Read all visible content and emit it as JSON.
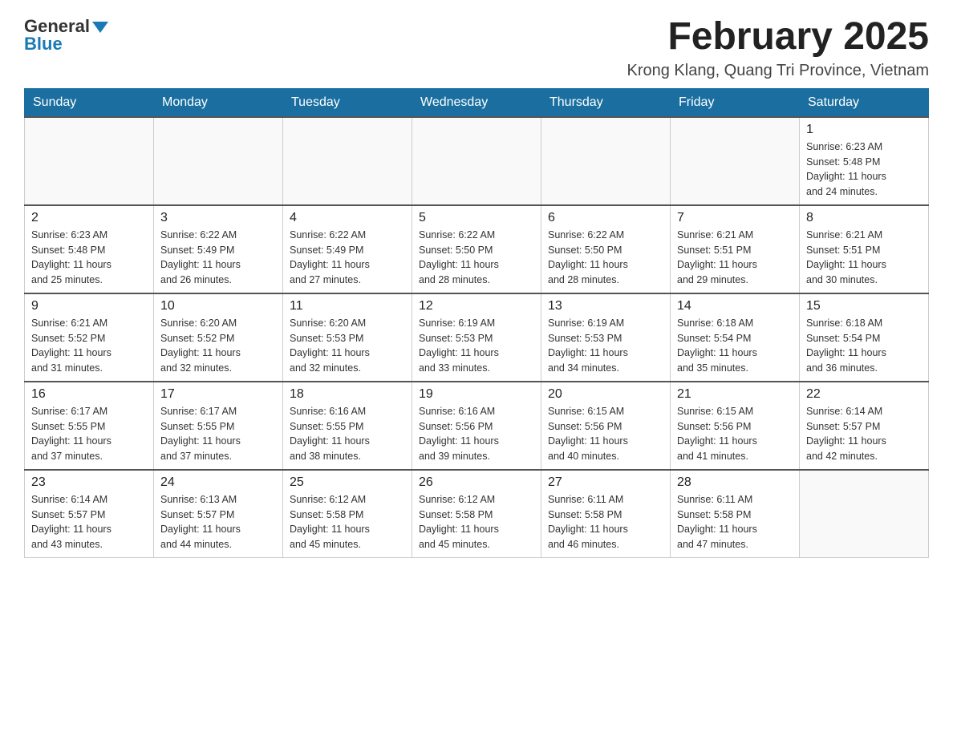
{
  "header": {
    "logo_general": "General",
    "logo_blue": "Blue",
    "month_title": "February 2025",
    "location": "Krong Klang, Quang Tri Province, Vietnam"
  },
  "days_of_week": [
    "Sunday",
    "Monday",
    "Tuesday",
    "Wednesday",
    "Thursday",
    "Friday",
    "Saturday"
  ],
  "weeks": [
    [
      {
        "day": "",
        "info": ""
      },
      {
        "day": "",
        "info": ""
      },
      {
        "day": "",
        "info": ""
      },
      {
        "day": "",
        "info": ""
      },
      {
        "day": "",
        "info": ""
      },
      {
        "day": "",
        "info": ""
      },
      {
        "day": "1",
        "info": "Sunrise: 6:23 AM\nSunset: 5:48 PM\nDaylight: 11 hours\nand 24 minutes."
      }
    ],
    [
      {
        "day": "2",
        "info": "Sunrise: 6:23 AM\nSunset: 5:48 PM\nDaylight: 11 hours\nand 25 minutes."
      },
      {
        "day": "3",
        "info": "Sunrise: 6:22 AM\nSunset: 5:49 PM\nDaylight: 11 hours\nand 26 minutes."
      },
      {
        "day": "4",
        "info": "Sunrise: 6:22 AM\nSunset: 5:49 PM\nDaylight: 11 hours\nand 27 minutes."
      },
      {
        "day": "5",
        "info": "Sunrise: 6:22 AM\nSunset: 5:50 PM\nDaylight: 11 hours\nand 28 minutes."
      },
      {
        "day": "6",
        "info": "Sunrise: 6:22 AM\nSunset: 5:50 PM\nDaylight: 11 hours\nand 28 minutes."
      },
      {
        "day": "7",
        "info": "Sunrise: 6:21 AM\nSunset: 5:51 PM\nDaylight: 11 hours\nand 29 minutes."
      },
      {
        "day": "8",
        "info": "Sunrise: 6:21 AM\nSunset: 5:51 PM\nDaylight: 11 hours\nand 30 minutes."
      }
    ],
    [
      {
        "day": "9",
        "info": "Sunrise: 6:21 AM\nSunset: 5:52 PM\nDaylight: 11 hours\nand 31 minutes."
      },
      {
        "day": "10",
        "info": "Sunrise: 6:20 AM\nSunset: 5:52 PM\nDaylight: 11 hours\nand 32 minutes."
      },
      {
        "day": "11",
        "info": "Sunrise: 6:20 AM\nSunset: 5:53 PM\nDaylight: 11 hours\nand 32 minutes."
      },
      {
        "day": "12",
        "info": "Sunrise: 6:19 AM\nSunset: 5:53 PM\nDaylight: 11 hours\nand 33 minutes."
      },
      {
        "day": "13",
        "info": "Sunrise: 6:19 AM\nSunset: 5:53 PM\nDaylight: 11 hours\nand 34 minutes."
      },
      {
        "day": "14",
        "info": "Sunrise: 6:18 AM\nSunset: 5:54 PM\nDaylight: 11 hours\nand 35 minutes."
      },
      {
        "day": "15",
        "info": "Sunrise: 6:18 AM\nSunset: 5:54 PM\nDaylight: 11 hours\nand 36 minutes."
      }
    ],
    [
      {
        "day": "16",
        "info": "Sunrise: 6:17 AM\nSunset: 5:55 PM\nDaylight: 11 hours\nand 37 minutes."
      },
      {
        "day": "17",
        "info": "Sunrise: 6:17 AM\nSunset: 5:55 PM\nDaylight: 11 hours\nand 37 minutes."
      },
      {
        "day": "18",
        "info": "Sunrise: 6:16 AM\nSunset: 5:55 PM\nDaylight: 11 hours\nand 38 minutes."
      },
      {
        "day": "19",
        "info": "Sunrise: 6:16 AM\nSunset: 5:56 PM\nDaylight: 11 hours\nand 39 minutes."
      },
      {
        "day": "20",
        "info": "Sunrise: 6:15 AM\nSunset: 5:56 PM\nDaylight: 11 hours\nand 40 minutes."
      },
      {
        "day": "21",
        "info": "Sunrise: 6:15 AM\nSunset: 5:56 PM\nDaylight: 11 hours\nand 41 minutes."
      },
      {
        "day": "22",
        "info": "Sunrise: 6:14 AM\nSunset: 5:57 PM\nDaylight: 11 hours\nand 42 minutes."
      }
    ],
    [
      {
        "day": "23",
        "info": "Sunrise: 6:14 AM\nSunset: 5:57 PM\nDaylight: 11 hours\nand 43 minutes."
      },
      {
        "day": "24",
        "info": "Sunrise: 6:13 AM\nSunset: 5:57 PM\nDaylight: 11 hours\nand 44 minutes."
      },
      {
        "day": "25",
        "info": "Sunrise: 6:12 AM\nSunset: 5:58 PM\nDaylight: 11 hours\nand 45 minutes."
      },
      {
        "day": "26",
        "info": "Sunrise: 6:12 AM\nSunset: 5:58 PM\nDaylight: 11 hours\nand 45 minutes."
      },
      {
        "day": "27",
        "info": "Sunrise: 6:11 AM\nSunset: 5:58 PM\nDaylight: 11 hours\nand 46 minutes."
      },
      {
        "day": "28",
        "info": "Sunrise: 6:11 AM\nSunset: 5:58 PM\nDaylight: 11 hours\nand 47 minutes."
      },
      {
        "day": "",
        "info": ""
      }
    ]
  ]
}
